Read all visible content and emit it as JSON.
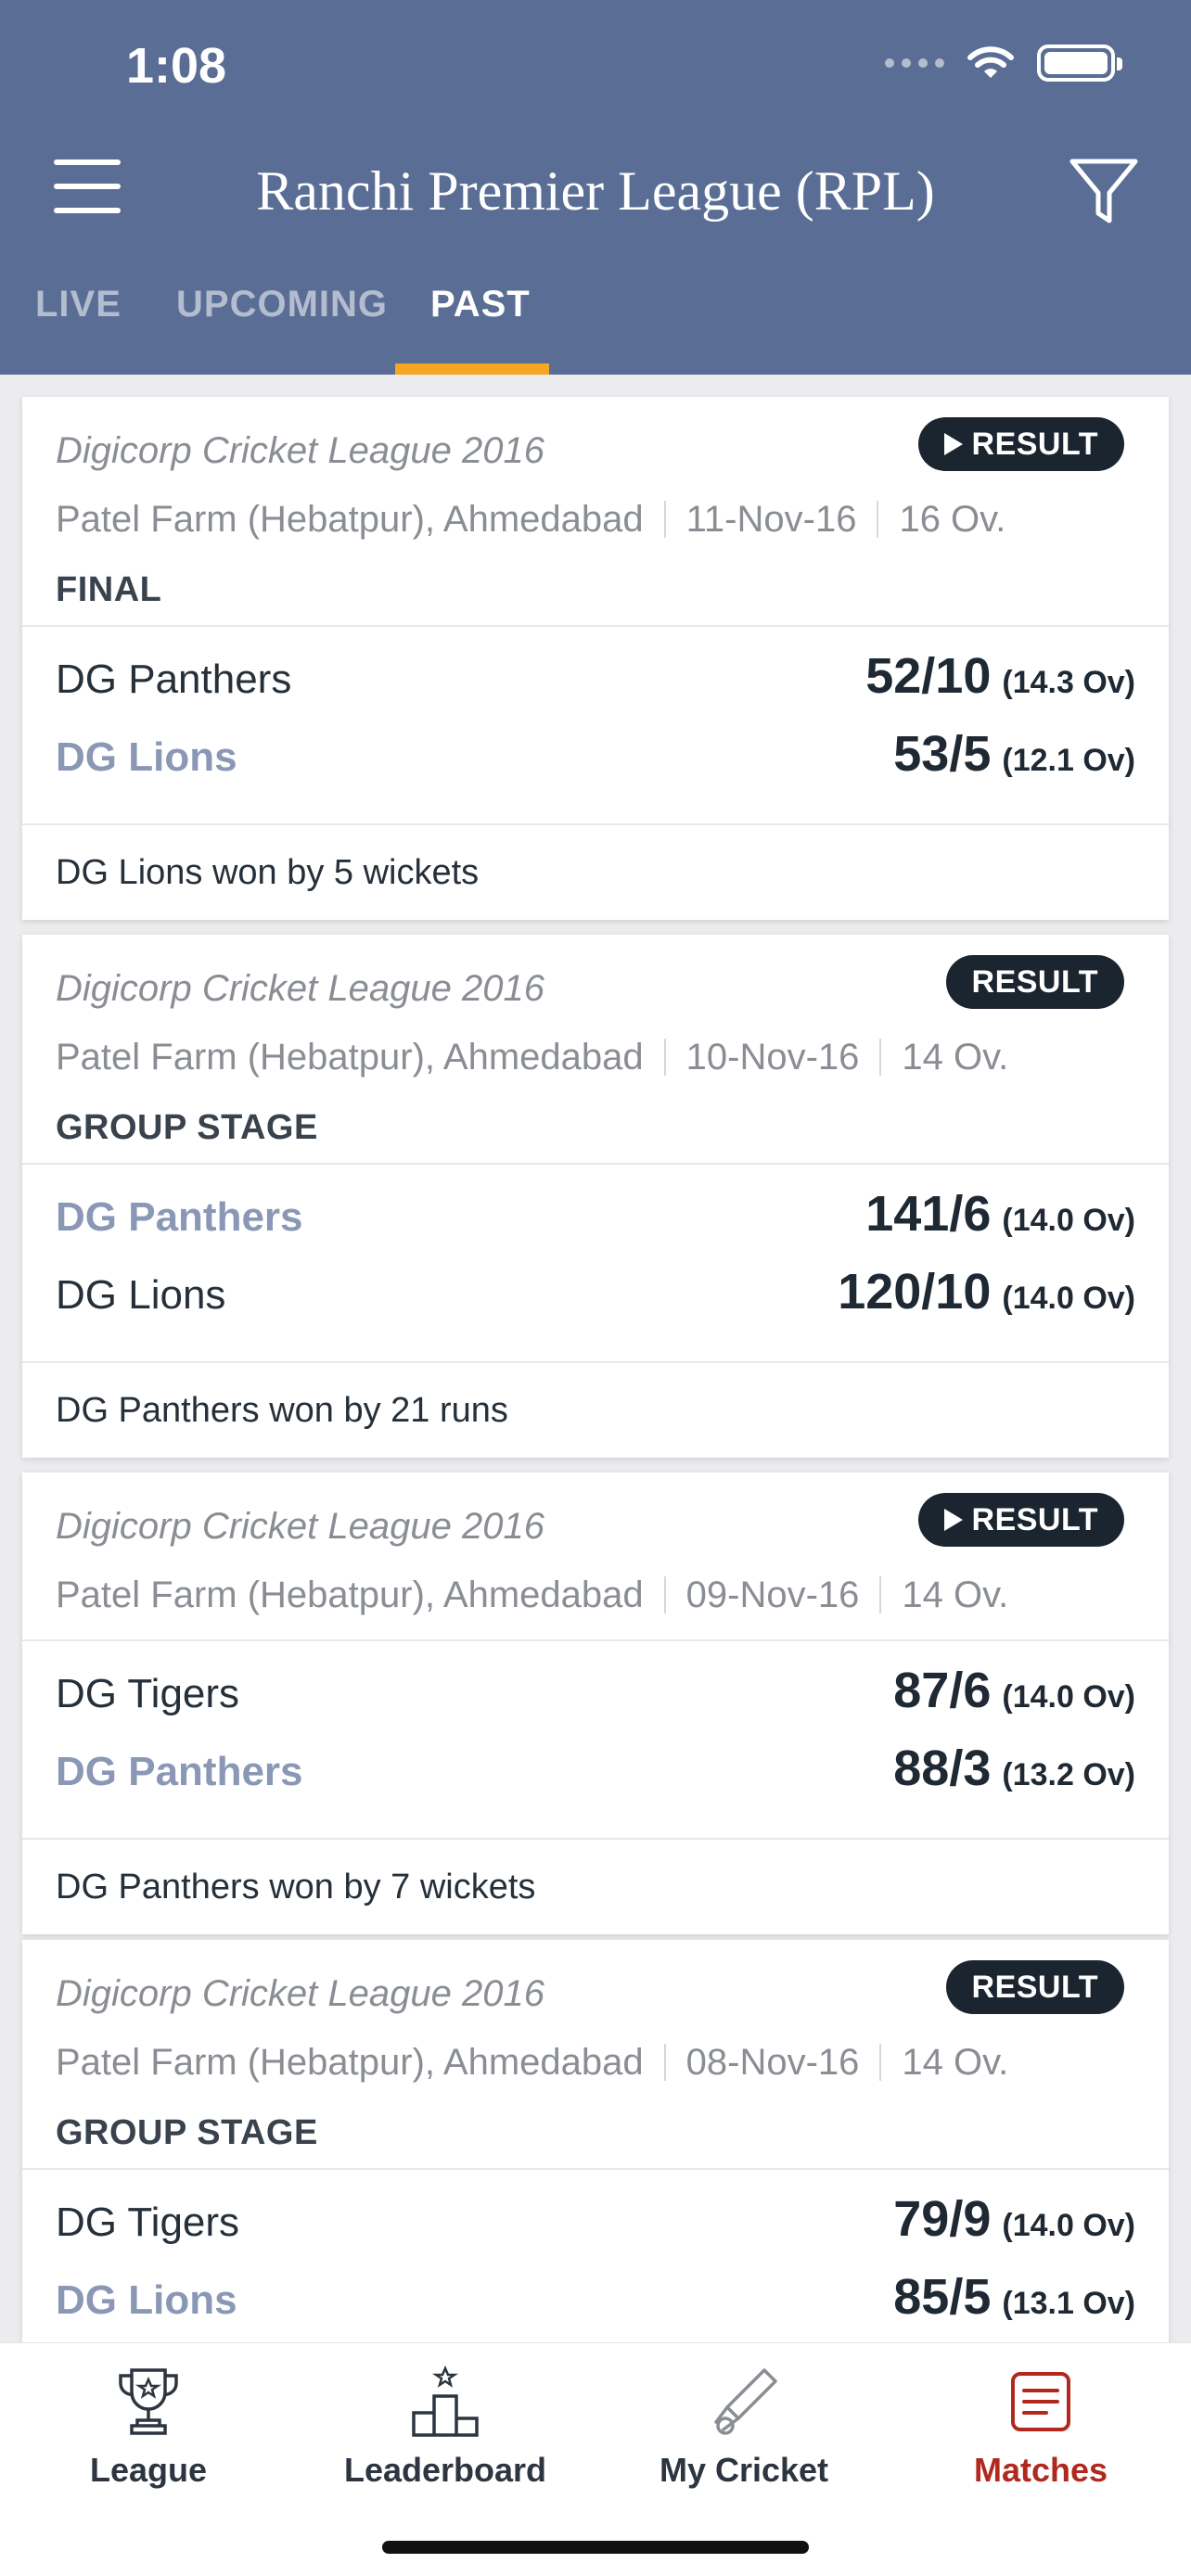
{
  "status_bar": {
    "time": "1:08"
  },
  "header": {
    "title": "Ranchi Premier League (RPL)"
  },
  "tabs": [
    {
      "label": "LIVE",
      "active": false
    },
    {
      "label": "UPCOMING",
      "active": false
    },
    {
      "label": "PAST",
      "active": true
    }
  ],
  "matches": [
    {
      "league": "Digicorp Cricket League 2016",
      "badge": "RESULT",
      "has_video": true,
      "venue": "Patel Farm (Hebatpur), Ahmedabad",
      "date": "11-Nov-16",
      "overs": "16 Ov.",
      "stage": "FINAL",
      "teams": [
        {
          "name": "DG Panthers",
          "score": "52/10",
          "overs": "(14.3 Ov)",
          "winner": false
        },
        {
          "name": "DG Lions",
          "score": "53/5",
          "overs": "(12.1 Ov)",
          "winner": true
        }
      ],
      "result": "DG Lions won by 5 wickets"
    },
    {
      "league": "Digicorp Cricket League 2016",
      "badge": "RESULT",
      "has_video": false,
      "venue": "Patel Farm (Hebatpur), Ahmedabad",
      "date": "10-Nov-16",
      "overs": "14 Ov.",
      "stage": "GROUP STAGE",
      "teams": [
        {
          "name": "DG Panthers",
          "score": "141/6",
          "overs": "(14.0 Ov)",
          "winner": true
        },
        {
          "name": "DG Lions",
          "score": "120/10",
          "overs": "(14.0 Ov)",
          "winner": false
        }
      ],
      "result": "DG Panthers won by 21 runs"
    },
    {
      "league": "Digicorp Cricket League 2016",
      "badge": "RESULT",
      "has_video": true,
      "venue": "Patel Farm (Hebatpur), Ahmedabad",
      "date": "09-Nov-16",
      "overs": "14 Ov.",
      "stage": "",
      "teams": [
        {
          "name": "DG Tigers",
          "score": "87/6",
          "overs": "(14.0 Ov)",
          "winner": false
        },
        {
          "name": "DG Panthers",
          "score": "88/3",
          "overs": "(13.2 Ov)",
          "winner": true
        }
      ],
      "result": "DG Panthers won by 7 wickets"
    },
    {
      "league": "Digicorp Cricket League 2016",
      "badge": "RESULT",
      "has_video": false,
      "venue": "Patel Farm (Hebatpur), Ahmedabad",
      "date": "08-Nov-16",
      "overs": "14 Ov.",
      "stage": "GROUP STAGE",
      "teams": [
        {
          "name": "DG Tigers",
          "score": "79/9",
          "overs": "(14.0 Ov)",
          "winner": false
        },
        {
          "name": "DG Lions",
          "score": "85/5",
          "overs": "(13.1 Ov)",
          "winner": true
        }
      ],
      "result": ""
    }
  ],
  "bottom_nav": [
    {
      "label": "League",
      "icon": "trophy-icon",
      "active": false
    },
    {
      "label": "Leaderboard",
      "icon": "podium-icon",
      "active": false
    },
    {
      "label": "My Cricket",
      "icon": "cricket-bat-icon",
      "active": false
    },
    {
      "label": "Matches",
      "icon": "matches-list-icon",
      "active": true
    }
  ],
  "colors": {
    "header_bg": "#5a6d95",
    "tab_indicator": "#f5a623",
    "badge_bg": "#1b2530",
    "winner_text": "#8a98b6",
    "nav_active": "#b0281e"
  }
}
